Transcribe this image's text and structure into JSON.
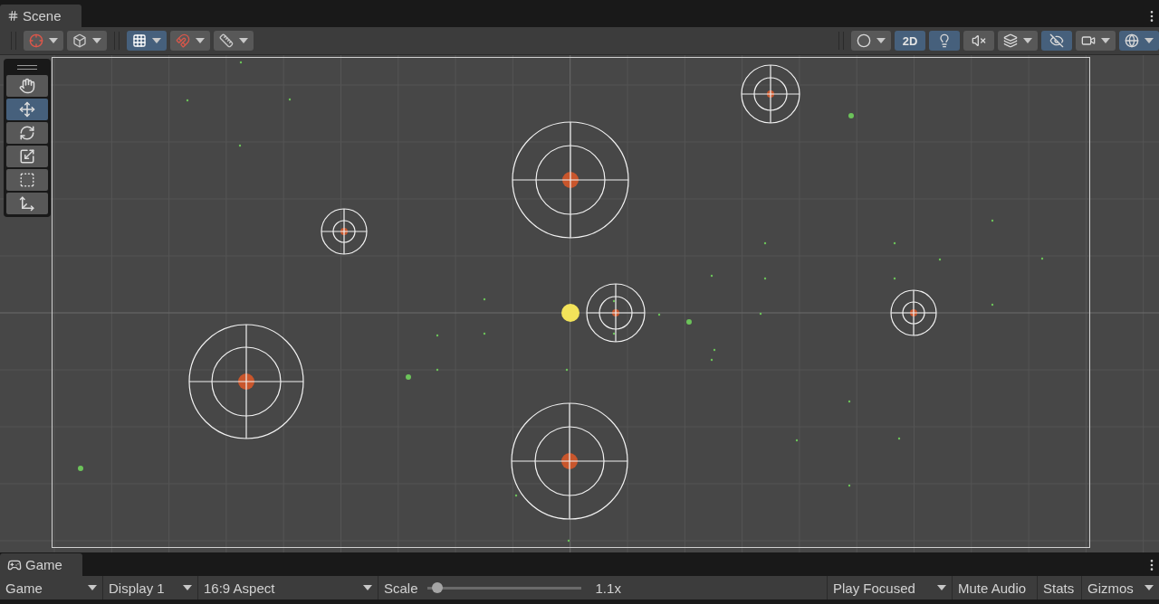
{
  "scene_tab": {
    "label": "Scene",
    "selected": true
  },
  "scene_toolbar": {
    "left": [
      {
        "selected": false,
        "dropdown": true
      },
      {
        "selected": false,
        "dropdown": true
      },
      {
        "selected": true,
        "dropdown": true
      },
      {
        "selected": false,
        "dropdown": true
      },
      {
        "selected": false,
        "dropdown": true
      }
    ],
    "right": [
      {
        "selected": false,
        "dropdown": true
      },
      {
        "label": "2D",
        "selected": true,
        "dropdown": false
      },
      {
        "selected": true,
        "dropdown": false
      },
      {
        "selected": false,
        "dropdown": false
      },
      {
        "selected": false,
        "dropdown": true
      },
      {
        "selected": true,
        "dropdown": false
      },
      {
        "selected": false,
        "dropdown": true
      },
      {
        "selected": true,
        "dropdown": true
      }
    ]
  },
  "tools": [
    {
      "selected": false
    },
    {
      "selected": true
    },
    {
      "selected": false
    },
    {
      "selected": false
    },
    {
      "selected": false
    },
    {
      "selected": false
    }
  ],
  "game_tab": {
    "label": "Game",
    "selected": true
  },
  "game_toolbar": {
    "view": "Game",
    "display": "Display 1",
    "aspect": "16:9 Aspect",
    "scale": {
      "label": "Scale",
      "level": 0.07,
      "reading": "1.1x"
    },
    "play_mode": "Play Focused",
    "mute_audio": {
      "label": "Mute Audio",
      "selected": false
    },
    "stats": {
      "label": "Stats",
      "selected": false
    },
    "gizmos": {
      "label": "Gizmos",
      "selected": false
    }
  }
}
